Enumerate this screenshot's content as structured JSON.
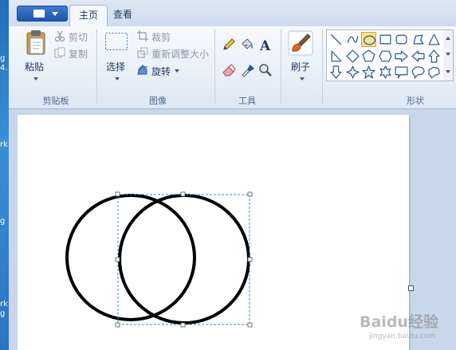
{
  "tabs": [
    {
      "label": "主页",
      "active": true
    },
    {
      "label": "查看",
      "active": false
    }
  ],
  "clipboard": {
    "group_label": "剪贴板",
    "paste_label": "粘贴",
    "cut_label": "剪切",
    "copy_label": "复制"
  },
  "image": {
    "group_label": "图像",
    "select_label": "选择",
    "crop_label": "裁剪",
    "resize_label": "重新调整大小",
    "rotate_label": "旋转"
  },
  "tools": {
    "group_label": "工具",
    "items": [
      "pencil-icon",
      "fill-bucket-icon",
      "text-icon",
      "eraser-icon",
      "color-picker-icon",
      "magnifier-icon"
    ]
  },
  "brushes": {
    "label": "刷子"
  },
  "shapes": {
    "group_label": "形状",
    "selected": "ellipse",
    "items": [
      "line",
      "curve",
      "ellipse",
      "rectangle",
      "rounded-rectangle",
      "polygon",
      "triangle",
      "right-triangle",
      "diamond",
      "pentagon",
      "hexagon",
      "arrow-right",
      "arrow-left",
      "arrow-up",
      "arrow-down",
      "star-4",
      "star-5",
      "star-6",
      "callout-rect",
      "callout-oval",
      "callout-cloud"
    ]
  },
  "desktop_fragments": [
    "g",
    "4.",
    "rk",
    "g",
    "rk",
    "g"
  ],
  "watermark": {
    "text": "Baidu经验",
    "url": "jingyan.baidu.com"
  },
  "colors": {
    "accent": "#3d7ad1",
    "ribbon": "#dde8f5",
    "selection": "#3c8bb9"
  }
}
